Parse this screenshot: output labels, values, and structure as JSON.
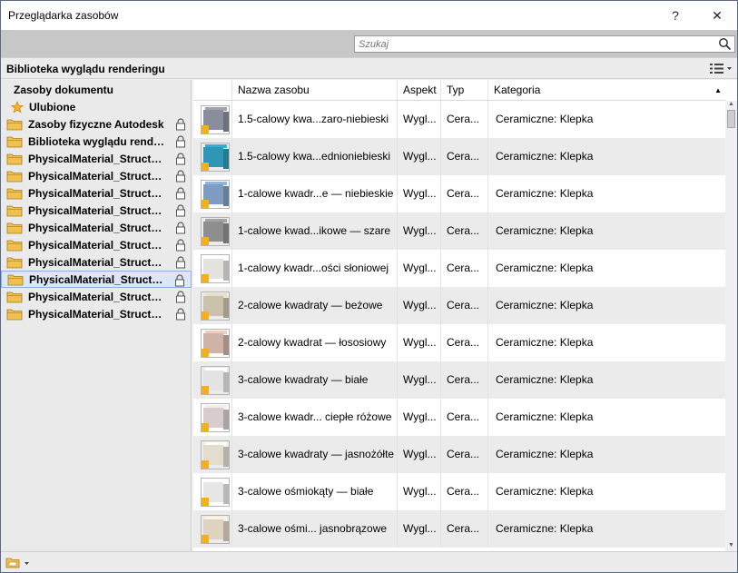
{
  "window": {
    "title": "Przeglądarka zasobów",
    "help_label": "?",
    "close_label": "✕"
  },
  "search": {
    "placeholder": "Szukaj"
  },
  "library": {
    "title": "Biblioteka wyglądu renderingu"
  },
  "tree": {
    "document_assets": "Zasoby dokumentu",
    "favorites": "Ulubione",
    "items": [
      {
        "label": "Zasoby fizyczne Autodesk",
        "locked": true,
        "selected": false
      },
      {
        "label": "Biblioteka wyglądu render...",
        "locked": true,
        "selected": false
      },
      {
        "label": "PhysicalMaterial_Structur...",
        "locked": true,
        "selected": false
      },
      {
        "label": "PhysicalMaterial_Structur...",
        "locked": true,
        "selected": false
      },
      {
        "label": "PhysicalMaterial_Structur...",
        "locked": true,
        "selected": false
      },
      {
        "label": "PhysicalMaterial_Structur...",
        "locked": true,
        "selected": false
      },
      {
        "label": "PhysicalMaterial_Structur...",
        "locked": true,
        "selected": false
      },
      {
        "label": "PhysicalMaterial_Structur...",
        "locked": true,
        "selected": false
      },
      {
        "label": "PhysicalMaterial_Structur...",
        "locked": true,
        "selected": false
      },
      {
        "label": "PhysicalMaterial_Structur...",
        "locked": true,
        "selected": true
      },
      {
        "label": "PhysicalMaterial_Structur...",
        "locked": true,
        "selected": false
      },
      {
        "label": "PhysicalMaterial_Structur...",
        "locked": true,
        "selected": false
      }
    ]
  },
  "table": {
    "columns": {
      "name": "Nazwa zasobu",
      "aspect": "Aspekt",
      "type": "Typ",
      "category": "Kategoria"
    },
    "rows": [
      {
        "name": "1.5-calowy kwa...zaro-niebieski",
        "aspect": "Wygl...",
        "type": "Cera...",
        "category": "Ceramiczne: Klepka",
        "color": "#8a8d9c"
      },
      {
        "name": "1.5-calowy kwa...ednioniebieski",
        "aspect": "Wygl...",
        "type": "Cera...",
        "category": "Ceramiczne: Klepka",
        "color": "#2f97b5"
      },
      {
        "name": "1-calowe kwadr...e — niebieskie",
        "aspect": "Wygl...",
        "type": "Cera...",
        "category": "Ceramiczne: Klepka",
        "color": "#7f9dc2"
      },
      {
        "name": "1-calowe kwad...ikowe — szare",
        "aspect": "Wygl...",
        "type": "Cera...",
        "category": "Ceramiczne: Klepka",
        "color": "#8e8e8e"
      },
      {
        "name": "1-calowy kwadr...ości słoniowej",
        "aspect": "Wygl...",
        "type": "Cera...",
        "category": "Ceramiczne: Klepka",
        "color": "#e4e2df"
      },
      {
        "name": "2-calowe kwadraty — beżowe",
        "aspect": "Wygl...",
        "type": "Cera...",
        "category": "Ceramiczne: Klepka",
        "color": "#cbc2ad"
      },
      {
        "name": "2-calowy kwadrat — łososiowy",
        "aspect": "Wygl...",
        "type": "Cera...",
        "category": "Ceramiczne: Klepka",
        "color": "#cfb2a8"
      },
      {
        "name": "3-calowe kwadraty — białe",
        "aspect": "Wygl...",
        "type": "Cera...",
        "category": "Ceramiczne: Klepka",
        "color": "#e3e3e3"
      },
      {
        "name": "3-calowe kwadr... ciepłe różowe",
        "aspect": "Wygl...",
        "type": "Cera...",
        "category": "Ceramiczne: Klepka",
        "color": "#d9cccc"
      },
      {
        "name": "3-calowe kwadraty — jasnożółte",
        "aspect": "Wygl...",
        "type": "Cera...",
        "category": "Ceramiczne: Klepka",
        "color": "#e2ddcf"
      },
      {
        "name": "3-calowe ośmiokąty — białe",
        "aspect": "Wygl...",
        "type": "Cera...",
        "category": "Ceramiczne: Klepka",
        "color": "#e6e6e6"
      },
      {
        "name": "3-calowe ośmi... jasnobrązowe",
        "aspect": "Wygl...",
        "type": "Cera...",
        "category": "Ceramiczne: Klepka",
        "color": "#ddd3c0"
      }
    ]
  },
  "icons": {
    "favorites": "star-icon",
    "folder": "folder-icon",
    "lock": "lock-icon",
    "search": "search-icon",
    "view": "list-view-icon",
    "library_menu": "library-menu-icon"
  },
  "colors": {
    "folder": "#f0c050",
    "selection": "#dce6f5",
    "badge": "#f2b01e"
  }
}
